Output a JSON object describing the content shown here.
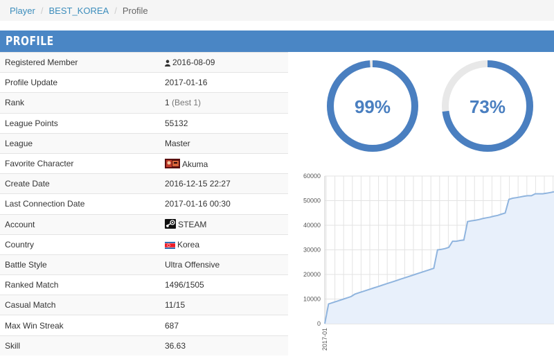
{
  "breadcrumb": {
    "items": [
      "Player",
      "BEST_KOREA"
    ],
    "current": "Profile"
  },
  "profile": {
    "header": "PROFILE",
    "rows": [
      {
        "label": "Registered Member",
        "value": "2016-08-09",
        "icon": "user-icon"
      },
      {
        "label": "Profile Update",
        "value": "2017-01-16"
      },
      {
        "label": "Rank",
        "value": "1",
        "value_suffix": "(Best 1)"
      },
      {
        "label": "League Points",
        "value": "55132"
      },
      {
        "label": "League",
        "value": "Master"
      },
      {
        "label": "Favorite Character",
        "value": "Akuma",
        "icon": "character-portrait-icon"
      },
      {
        "label": "Create Date",
        "value": "2016-12-15 22:27"
      },
      {
        "label": "Last Connection Date",
        "value": "2017-01-16 00:30"
      },
      {
        "label": "Account",
        "value": "STEAM",
        "icon": "steam-icon"
      },
      {
        "label": "Country",
        "value": "Korea",
        "icon": "korea-flag-icon"
      },
      {
        "label": "Battle Style",
        "value": "Ultra Offensive"
      },
      {
        "label": "Ranked Match",
        "value": "1496/1505"
      },
      {
        "label": "Casual Match",
        "value": "11/15"
      },
      {
        "label": "Max Win Streak",
        "value": "687"
      },
      {
        "label": "Skill",
        "value": "36.63"
      }
    ]
  },
  "gauges": [
    {
      "value": 99,
      "label": "99%"
    },
    {
      "value": 73,
      "label": "73%"
    }
  ],
  "colors": {
    "accent": "#4a86c5",
    "gauge_fill": "#4a7fc0",
    "gauge_track": "#e8e8e8",
    "link": "#3c8dbc",
    "chart_line": "#8fb4de",
    "chart_area": "#e8f0fb"
  },
  "chart_data": {
    "type": "area",
    "title": "",
    "xlabel": "",
    "ylabel": "",
    "x_tick_labels": [
      "2017-01"
    ],
    "y_ticks": [
      0,
      10000,
      20000,
      30000,
      40000,
      50000,
      60000
    ],
    "y_tick_labels": [
      "0",
      "10000",
      "20000",
      "30000",
      "40000",
      "50000",
      "60000"
    ],
    "ylim": [
      0,
      60000
    ],
    "grid": true,
    "series": [
      {
        "values": [
          0,
          8000,
          8500,
          9000,
          9500,
          10000,
          10500,
          11000,
          12000,
          12500,
          13000,
          13500,
          14000,
          14500,
          15000,
          15500,
          16000,
          16500,
          17000,
          17500,
          18000,
          18500,
          19000,
          19500,
          20000,
          20500,
          21000,
          21500,
          22000,
          22500,
          30000,
          30200,
          30500,
          31000,
          33500,
          33500,
          33800,
          34000,
          41500,
          41800,
          42000,
          42300,
          42700,
          43000,
          43300,
          43700,
          44000,
          44500,
          45000,
          50500,
          51000,
          51200,
          51500,
          51800,
          52000,
          52000,
          52800,
          52800,
          52800,
          53000,
          53300,
          53600
        ]
      }
    ]
  }
}
